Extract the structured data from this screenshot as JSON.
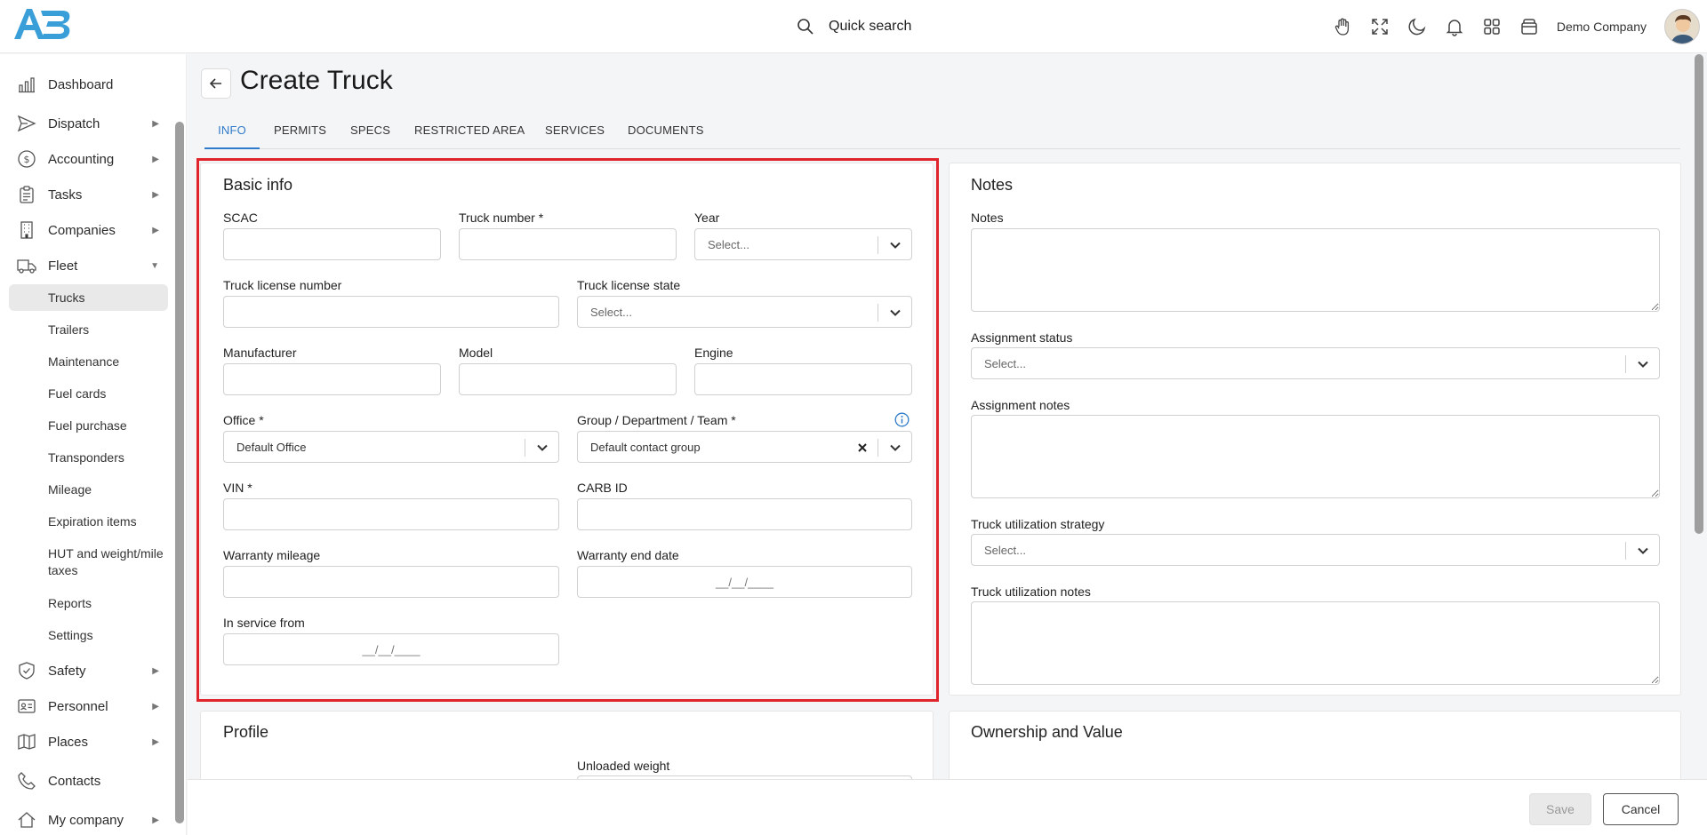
{
  "header": {
    "search_label": "Quick search",
    "company": "Demo Company",
    "icons": [
      "hand-icon",
      "fullscreen-icon",
      "moon-icon",
      "bell-icon",
      "apps-grid-icon",
      "wallet-icon"
    ]
  },
  "sidebar": {
    "items": [
      {
        "label": "Dashboard",
        "icon": "bar-chart-icon",
        "expandable": false
      },
      {
        "label": "Dispatch",
        "icon": "send-icon",
        "expandable": true
      },
      {
        "label": "Accounting",
        "icon": "dollar-icon",
        "expandable": true
      },
      {
        "label": "Tasks",
        "icon": "clipboard-icon",
        "expandable": true
      },
      {
        "label": "Companies",
        "icon": "building-icon",
        "expandable": true
      },
      {
        "label": "Fleet",
        "icon": "truck-icon",
        "expandable": true,
        "expanded": true
      },
      {
        "label": "Safety",
        "icon": "shield-icon",
        "expandable": true
      },
      {
        "label": "Personnel",
        "icon": "id-card-icon",
        "expandable": true
      },
      {
        "label": "Places",
        "icon": "map-icon",
        "expandable": true
      },
      {
        "label": "Contacts",
        "icon": "phone-icon",
        "expandable": false
      },
      {
        "label": "My company",
        "icon": "home-icon",
        "expandable": true
      }
    ],
    "fleet_sub": [
      "Trucks",
      "Trailers",
      "Maintenance",
      "Fuel cards",
      "Fuel purchase",
      "Transponders",
      "Mileage",
      "Expiration items",
      "HUT and weight/mile taxes",
      "Reports",
      "Settings"
    ],
    "fleet_sub_active": "Trucks"
  },
  "page": {
    "title": "Create Truck",
    "tabs": [
      "INFO",
      "PERMITS",
      "SPECS",
      "RESTRICTED AREA",
      "SERVICES",
      "DOCUMENTS"
    ],
    "active_tab": "INFO"
  },
  "basic_info": {
    "title": "Basic info",
    "scac_label": "SCAC",
    "truck_number_label": "Truck number *",
    "year_label": "Year",
    "year_placeholder": "Select...",
    "license_number_label": "Truck license number",
    "license_state_label": "Truck license state",
    "license_state_placeholder": "Select...",
    "manufacturer_label": "Manufacturer",
    "model_label": "Model",
    "engine_label": "Engine",
    "office_label": "Office *",
    "office_value": "Default Office",
    "group_label": "Group / Department / Team *",
    "group_value": "Default contact group",
    "vin_label": "VIN *",
    "carb_label": "CARB ID",
    "warranty_mileage_label": "Warranty mileage",
    "warranty_end_label": "Warranty end date",
    "warranty_end_placeholder": "__/__/____",
    "in_service_label": "In service from",
    "in_service_placeholder": "__/__/____"
  },
  "notes": {
    "title": "Notes",
    "notes_label": "Notes",
    "assignment_status_label": "Assignment status",
    "assignment_status_placeholder": "Select...",
    "assignment_notes_label": "Assignment notes",
    "utilization_strategy_label": "Truck utilization strategy",
    "utilization_strategy_placeholder": "Select...",
    "utilization_notes_label": "Truck utilization notes"
  },
  "profile": {
    "title": "Profile",
    "unloaded_weight_label": "Unloaded weight"
  },
  "ownership": {
    "title": "Ownership and Value"
  },
  "footer": {
    "save_label": "Save",
    "cancel_label": "Cancel"
  },
  "colors": {
    "accent": "#2f7ac9",
    "highlight": "#e0242b",
    "logo": "#3a9fd8"
  }
}
